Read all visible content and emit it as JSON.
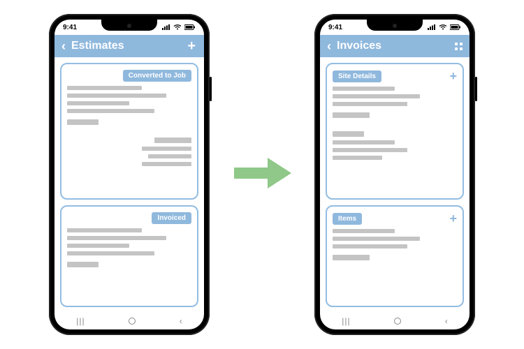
{
  "status": {
    "time": "9:41"
  },
  "colors": {
    "accent": "#8fb8dd",
    "arrow": "#8fc888",
    "skeleton": "#c4c4c4"
  },
  "phone_left": {
    "header": {
      "title": "Estimates",
      "action_icon": "plus-icon"
    },
    "cards": [
      {
        "badge": "Converted to Job",
        "badge_align": "right"
      },
      {
        "badge": "Invoiced",
        "badge_align": "right"
      }
    ]
  },
  "phone_right": {
    "header": {
      "title": "Invoices",
      "action_icon": "expand-icon"
    },
    "cards": [
      {
        "badge": "Site Details",
        "badge_align": "left",
        "has_add": true
      },
      {
        "badge": "Items",
        "badge_align": "left",
        "has_add": true
      }
    ]
  }
}
